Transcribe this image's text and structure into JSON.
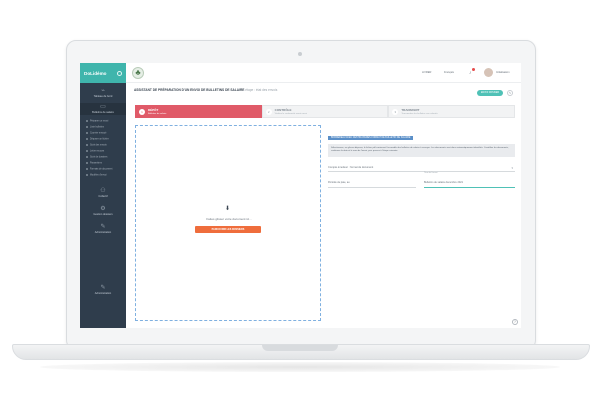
{
  "app": {
    "name": "DoLidémo"
  },
  "sidebar": {
    "items": [
      {
        "label": "Tableau de bord",
        "icon": "chart-icon"
      },
      {
        "label": "Bulletins de salaire",
        "icon": "folder-icon"
      },
      {
        "label": "Collectif",
        "icon": "people-icon"
      },
      {
        "label": "Gestion dossiers",
        "icon": "gear-icon"
      },
      {
        "label": "Administration",
        "icon": "user-icon"
      },
      {
        "label": "Administration",
        "icon": "user-icon"
      }
    ],
    "subitems": [
      "Préparer un envoi",
      "Liste bulletins",
      "Courrier envoyé",
      "Déposer un fichier",
      "Suivi des envois",
      "Lettre recours",
      "Suivi de dossiers",
      "Paramètres",
      "Formats de document",
      "Modèles d'envoi"
    ]
  },
  "topbar": {
    "link": "LIVRER",
    "lang": "Français",
    "user": "Initialisation"
  },
  "page": {
    "title": "ASSISTANT DE PRÉPARATION D'UN ENVOI DE BULLETINS DE SALAIRE",
    "subtitle": "étape : état des envois"
  },
  "header_buttons": {
    "action": "ENVOI DOSSIER",
    "round": "✎"
  },
  "steps": [
    {
      "num": "1",
      "label": "DÉPÔT",
      "desc": "Bulletins de salaire"
    },
    {
      "num": "2",
      "label": "CONTRÔLE",
      "desc": "Vérifiez la conformité avant envoi"
    },
    {
      "num": "3",
      "label": "TRANSFERT",
      "desc": "Transmettez les bulletins aux salariés"
    }
  ],
  "dropzone": {
    "text": "Faites glisser votre document ici...",
    "button": "PARCOURIR LES DOSSIERS"
  },
  "panel": {
    "tag": "BORDEREAU AVEC DESTINATAIRES FORMAT DE BULLETIN DE SALAIRE",
    "info": "Sélectionnez, au glisser-déposer, le fichier pdf contenant l'ensemble des bulletins de salaire à envoyer. Les documents sont alors automatiquement identifiés. Contrôlez les documents, confirmez la date et le nom de l'envoi, puis passez à l'étape suivante.",
    "select": "Compte émetteur : format de document",
    "field1_label": "",
    "field1_value": "Période de paie, au",
    "field2_label": "Titre de l'envoi",
    "field2_value": "Bulletins de salaire décembre 2021"
  },
  "colors": {
    "brand": "#3fb5ac",
    "active_step": "#e05a68",
    "button": "#ef6d3c",
    "sidebar": "#2f3d4c"
  }
}
